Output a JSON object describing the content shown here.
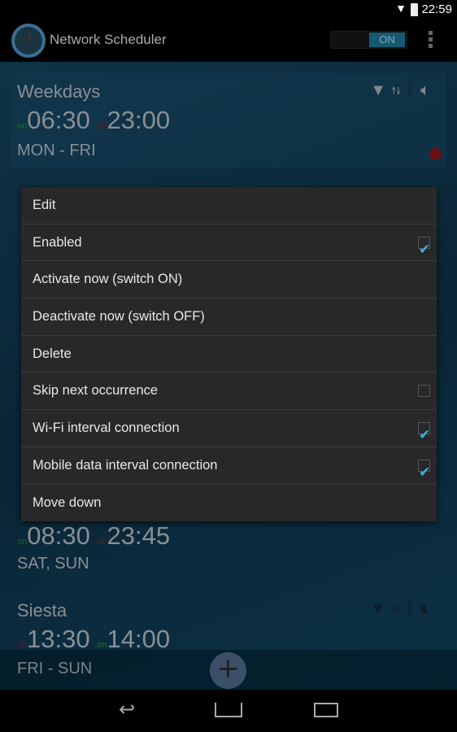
{
  "status_bar": {
    "time": "22:59",
    "wifi_icon": "wifi-icon",
    "battery_icon": "battery-icon"
  },
  "action_bar": {
    "title": "Network Scheduler",
    "toggle_label": "ON",
    "overflow_icon": "overflow-menu-icon"
  },
  "schedules": [
    {
      "name": "Weekdays",
      "first_label": "on",
      "first_time": "06:30",
      "second_label": "off",
      "second_time": "23:00",
      "days": "MON - FRI",
      "icons": [
        "wifi-icon",
        "mobile-data-icon",
        "bluetooth-icon",
        "volume-icon"
      ],
      "status_dot": "#6b0f12"
    },
    {
      "name": "",
      "first_label": "on",
      "first_time": "08:30",
      "second_label": "off",
      "second_time": "23:45",
      "days": "SAT, SUN"
    },
    {
      "name": "Siesta",
      "first_label": "off",
      "first_time": "13:30",
      "second_label": "on",
      "second_time": "14:00",
      "days": "FRI - SUN",
      "icons": [
        "wifi-icon",
        "mobile-data-icon",
        "bluetooth-icon",
        "volume-muted-icon"
      ]
    }
  ],
  "context_menu": {
    "items": [
      {
        "label": "Edit"
      },
      {
        "label": "Enabled",
        "checkbox": true
      },
      {
        "label": "Activate now (switch ON)"
      },
      {
        "label": "Deactivate now (switch OFF)"
      },
      {
        "label": "Delete"
      },
      {
        "label": "Skip next occurrence",
        "checkbox": false
      },
      {
        "label": "Wi-Fi interval connection",
        "checkbox": true
      },
      {
        "label": "Mobile data interval connection",
        "checkbox": true
      },
      {
        "label": "Move down"
      }
    ]
  },
  "colors": {
    "accent": "#33b5e5",
    "on": "#1d6a1d",
    "off": "#6b1515",
    "menu_bg": "#282828"
  }
}
